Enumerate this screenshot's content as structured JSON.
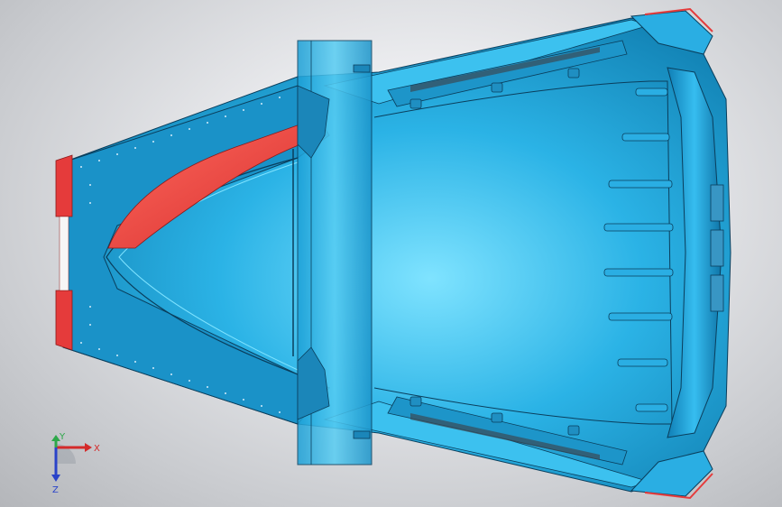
{
  "triad": {
    "x_label": "X",
    "y_label": "Y",
    "z_label": "Z"
  },
  "colors": {
    "part_blue": "#1fa3d9",
    "part_blue_light": "#6fd6f7",
    "part_blue_dark": "#0b6f9c",
    "edge": "#0a3e5c",
    "cut_face": "#e53b3b",
    "axis_x": "#d42a2a",
    "axis_y": "#2ea84a",
    "axis_z": "#2a43c9"
  },
  "icons": {
    "triad": "coordinate-triad-icon"
  }
}
